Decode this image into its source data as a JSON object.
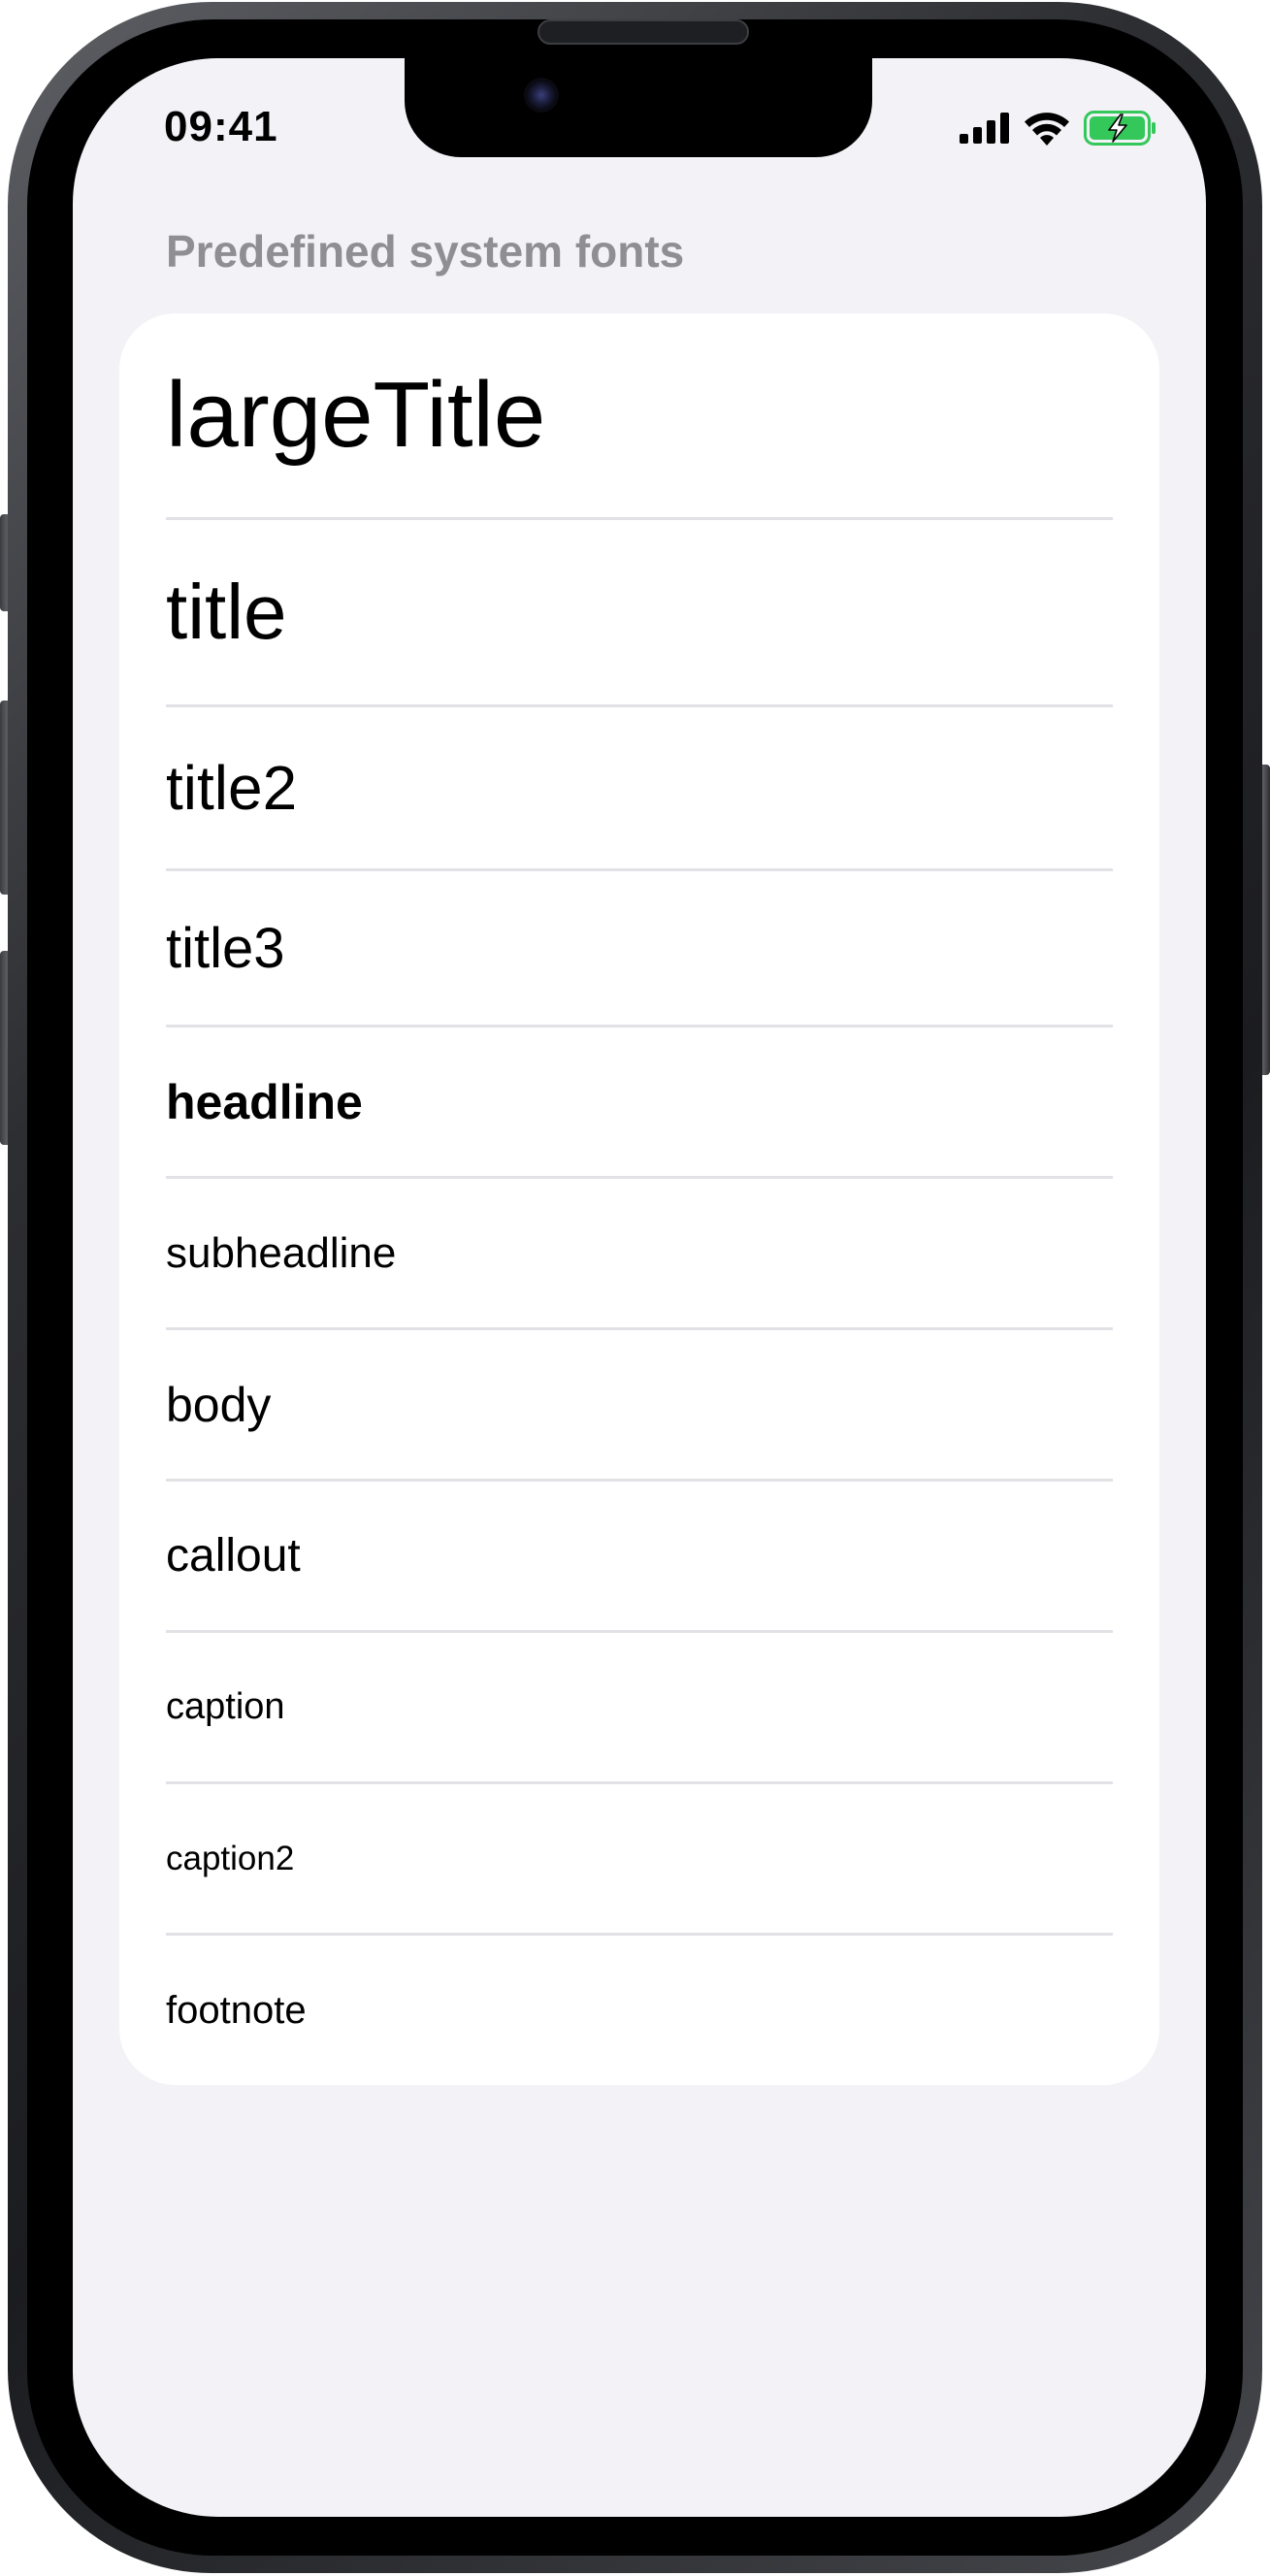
{
  "status_bar": {
    "time": "09:41",
    "icons": [
      "cellular-signal-icon",
      "wifi-icon",
      "battery-charging-icon"
    ],
    "battery_color": "#34c759"
  },
  "section": {
    "header": "Predefined system fonts"
  },
  "font_list": {
    "items": [
      {
        "label": "largeTitle"
      },
      {
        "label": "title"
      },
      {
        "label": "title2"
      },
      {
        "label": "title3"
      },
      {
        "label": "headline"
      },
      {
        "label": "subheadline"
      },
      {
        "label": "body"
      },
      {
        "label": "callout"
      },
      {
        "label": "caption"
      },
      {
        "label": "caption2"
      },
      {
        "label": "footnote"
      }
    ]
  },
  "colors": {
    "background": "#f2f2f7",
    "card": "#ffffff",
    "header_text": "#8e8e93",
    "divider": "#e2e2e6"
  }
}
